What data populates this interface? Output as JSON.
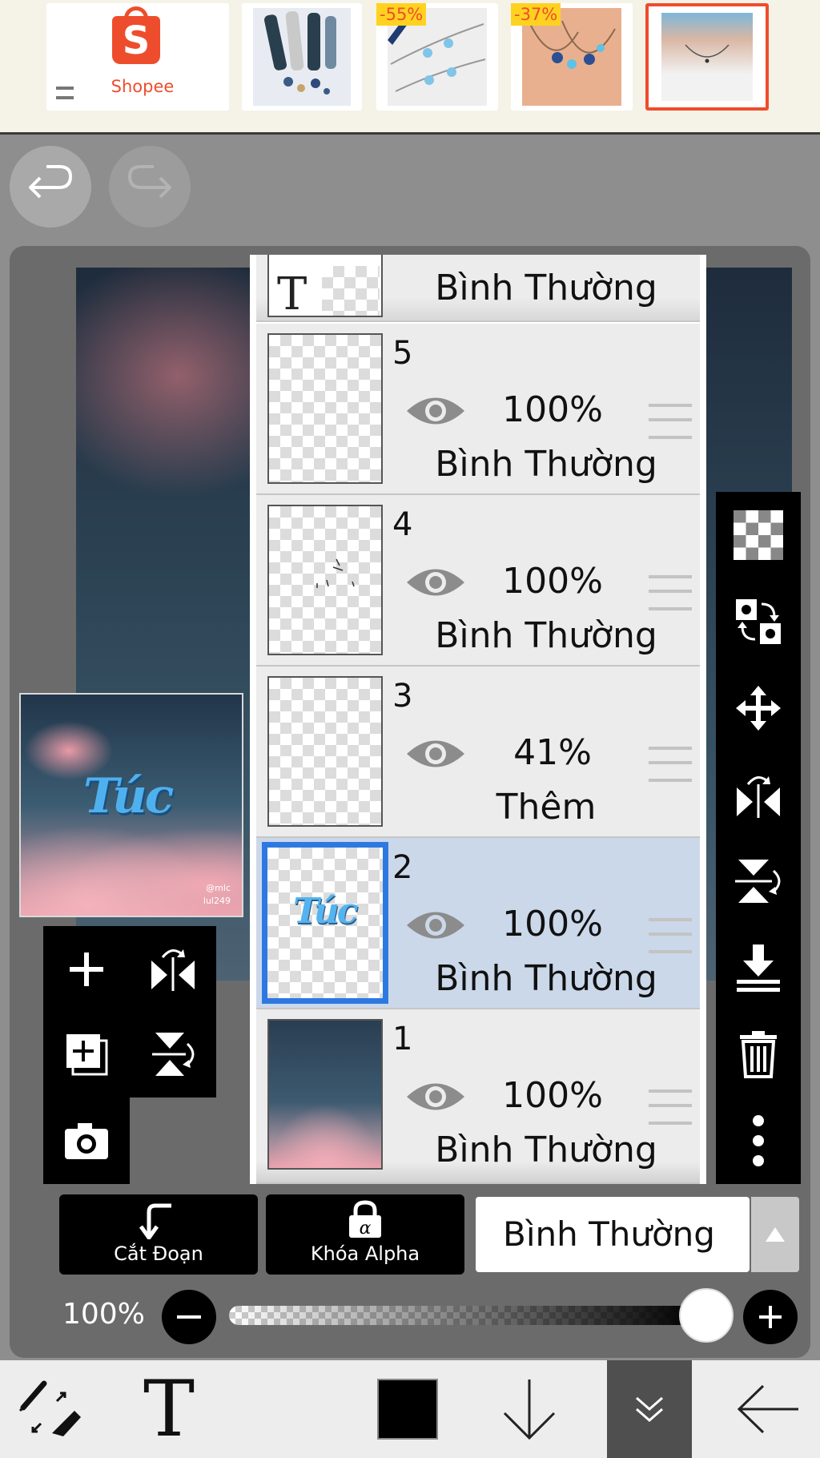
{
  "ad": {
    "brand": "Shopee",
    "brand_color": "#ee4d2d",
    "products": [
      {
        "discount": ""
      },
      {
        "discount": "-55%"
      },
      {
        "discount": "-37%"
      },
      {
        "discount": ""
      }
    ]
  },
  "layers": [
    {
      "number": "",
      "opacity": "",
      "blend": "Bình Thường",
      "type": "text",
      "thumb_glyph": "T",
      "selected": false
    },
    {
      "number": "5",
      "opacity": "100%",
      "blend": "Bình Thường",
      "selected": false
    },
    {
      "number": "4",
      "opacity": "100%",
      "blend": "Bình Thường",
      "selected": false
    },
    {
      "number": "3",
      "opacity": "41%",
      "blend": "Thêm",
      "selected": false
    },
    {
      "number": "2",
      "opacity": "100%",
      "blend": "Bình Thường",
      "selected": true
    },
    {
      "number": "1",
      "opacity": "100%",
      "blend": "Bình Thường",
      "selected": false
    }
  ],
  "preview": {
    "text": "Túc",
    "signature_line1": "@mlc",
    "signature_line2": "lul249"
  },
  "layer_controls": {
    "clip_label": "Cắt Đoạn",
    "alpha_lock_label": "Khóa Alpha",
    "blend_mode": "Bình Thường",
    "opacity_label": "100%",
    "opacity_level": 1.0
  },
  "right_toolbar_icons": [
    "transparent-icon",
    "transform-icon",
    "move-icon",
    "flip-horizontal-icon",
    "flip-vertical-icon",
    "merge-down-icon",
    "trash-icon",
    "more-icon"
  ],
  "left_tools_icons": [
    "add-layer-icon",
    "flip-horizontal-icon",
    "duplicate-layer-icon",
    "flip-vertical-icon",
    "camera-icon"
  ],
  "bottom_nav_icons": [
    "brush-eraser-icon",
    "text-tool-icon",
    "color-swatch",
    "arrow-down-icon",
    "chevron-double-down-icon",
    "back-arrow-icon"
  ],
  "text_tool_glyph": "T",
  "current_color": "#000000",
  "selected_accent": "#2e79e1"
}
